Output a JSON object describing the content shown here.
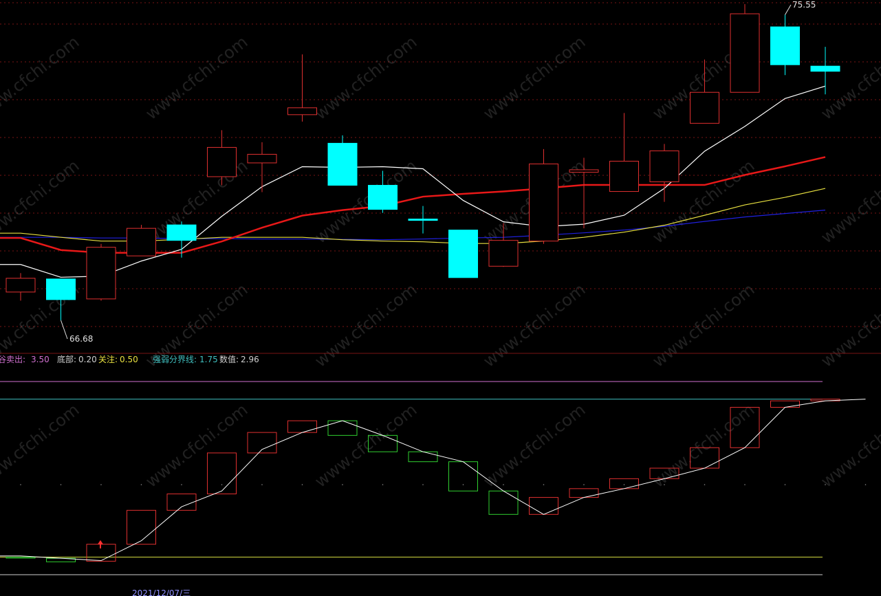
{
  "colors": {
    "background": "#000000",
    "up": "#e03030",
    "down": "#00ffff",
    "grid": "#7a1515",
    "ma5": "#ffffff",
    "ma10": "#e81818",
    "ma20": "#e8e040",
    "ma60": "#2020e0",
    "osc_up": "#e03030",
    "osc_down": "#30d030",
    "osc_line": "#ffffff",
    "line_sell": "#d070d0",
    "line_attention": "#40c0c0",
    "line_strong": "#d8e040",
    "line_bottom": "#d0d0d0"
  },
  "watermark": "www.cfchi.com",
  "price_panel": {
    "high_annotation": "75.55",
    "low_annotation": "66.68"
  },
  "indicator_panel": {
    "legend": [
      {
        "label": "谷卖出:",
        "value": "3.50",
        "color": "#d070d0"
      },
      {
        "label": "底部:",
        "value": "0.20",
        "color": "#d0d0d0"
      },
      {
        "label": "关注:",
        "value": "0.50",
        "color": "#e8e040"
      },
      {
        "label": "强弱分界线:",
        "value": "1.75",
        "color": "#40c0c0"
      },
      {
        "label": "数值:",
        "value": "2.96",
        "color": "#d0d0d0"
      }
    ],
    "bottom_date": "2021/12/07/三"
  },
  "chart_data": [
    {
      "type": "candlestick",
      "ylim": [
        65.9,
        75.9
      ],
      "candles": [
        {
          "o": 67.5,
          "c": 67.9,
          "h": 68.05,
          "l": 67.25,
          "dir": "up"
        },
        {
          "o": 67.88,
          "c": 67.28,
          "h": 67.88,
          "l": 66.68,
          "dir": "down"
        },
        {
          "o": 67.3,
          "c": 68.8,
          "h": 68.9,
          "l": 67.25,
          "dir": "up"
        },
        {
          "o": 68.55,
          "c": 69.35,
          "h": 69.45,
          "l": 68.55,
          "dir": "up"
        },
        {
          "o": 69.45,
          "c": 69.0,
          "h": 69.55,
          "l": 68.5,
          "dir": "down"
        },
        {
          "o": 70.85,
          "c": 71.7,
          "h": 72.2,
          "l": 70.6,
          "dir": "up"
        },
        {
          "o": 71.25,
          "c": 71.5,
          "h": 71.85,
          "l": 70.4,
          "dir": "up"
        },
        {
          "o": 72.65,
          "c": 72.85,
          "h": 74.4,
          "l": 72.45,
          "dir": "up"
        },
        {
          "o": 71.82,
          "c": 70.6,
          "h": 72.05,
          "l": 70.6,
          "dir": "down"
        },
        {
          "o": 70.6,
          "c": 69.9,
          "h": 71.02,
          "l": 69.8,
          "dir": "down"
        },
        {
          "o": 69.62,
          "c": 69.58,
          "h": 70.0,
          "l": 69.2,
          "dir": "down"
        },
        {
          "o": 69.3,
          "c": 67.92,
          "h": 69.3,
          "l": 67.92,
          "dir": "down"
        },
        {
          "o": 68.25,
          "c": 69.0,
          "h": 69.5,
          "l": 68.23,
          "dir": "up"
        },
        {
          "o": 68.98,
          "c": 71.22,
          "h": 71.65,
          "l": 68.9,
          "dir": "up"
        },
        {
          "o": 70.98,
          "c": 71.05,
          "h": 71.4,
          "l": 69.35,
          "dir": "up"
        },
        {
          "o": 70.42,
          "c": 71.3,
          "h": 72.7,
          "l": 70.42,
          "dir": "up"
        },
        {
          "o": 70.7,
          "c": 71.6,
          "h": 71.8,
          "l": 70.12,
          "dir": "up"
        },
        {
          "o": 72.4,
          "c": 73.3,
          "h": 74.25,
          "l": 72.4,
          "dir": "up"
        },
        {
          "o": 73.3,
          "c": 75.58,
          "h": 75.86,
          "l": 73.3,
          "dir": "up"
        },
        {
          "o": 75.2,
          "c": 74.1,
          "h": 75.55,
          "l": 73.8,
          "dir": "down"
        },
        {
          "o": 74.06,
          "c": 73.91,
          "h": 74.62,
          "l": 73.24,
          "dir": "down"
        }
      ],
      "ma_lines": [
        {
          "name": "MA5",
          "color": "#ffffff",
          "values": [
            68.3,
            67.93,
            67.96,
            68.4,
            68.74,
            69.7,
            70.56,
            71.14,
            71.12,
            71.14,
            71.08,
            70.16,
            69.54,
            69.4,
            69.47,
            69.73,
            70.51,
            71.59,
            72.31,
            73.12,
            73.48
          ]
        },
        {
          "name": "MA10",
          "color": "#e81818",
          "values": [
            69.07,
            68.72,
            68.64,
            68.64,
            68.64,
            68.97,
            69.37,
            69.72,
            69.88,
            70.0,
            70.27,
            70.35,
            70.42,
            70.51,
            70.61,
            70.61,
            70.61,
            70.61,
            70.9,
            71.15,
            71.42
          ]
        },
        {
          "name": "MA20",
          "color": "#e8e040",
          "values": [
            69.21,
            69.09,
            68.98,
            68.98,
            69.03,
            69.09,
            69.09,
            69.09,
            69.02,
            68.98,
            68.96,
            68.91,
            68.91,
            68.98,
            69.09,
            69.24,
            69.44,
            69.73,
            70.03,
            70.25,
            70.51
          ]
        },
        {
          "name": "MA60",
          "color": "#2020e0",
          "values": [
            69.09,
            69.09,
            69.07,
            69.07,
            69.05,
            69.05,
            69.04,
            69.04,
            69.03,
            69.02,
            69.04,
            69.07,
            69.09,
            69.15,
            69.22,
            69.3,
            69.41,
            69.55,
            69.68,
            69.78,
            69.88
          ]
        }
      ]
    },
    {
      "type": "indicator",
      "ylim": [
        0.0,
        3.7
      ],
      "reference_lines": [
        {
          "name": "谷卖出",
          "value": 3.5,
          "color": "#d070d0"
        },
        {
          "name": "强弱分界线",
          "value": 3.2,
          "color": "#40c0c0"
        },
        {
          "name": "关注",
          "value": 0.5,
          "color": "#d8e040"
        },
        {
          "name": "底部",
          "value": 0.2,
          "color": "#d0d0d0"
        }
      ],
      "boxes": [
        {
          "o": 0.5,
          "c": 0.5,
          "dir": "flat"
        },
        {
          "o": 0.48,
          "c": 0.42,
          "dir": "down"
        },
        {
          "o": 0.43,
          "c": 0.72,
          "dir": "up"
        },
        {
          "o": 0.72,
          "c": 1.3,
          "dir": "up"
        },
        {
          "o": 1.3,
          "c": 1.58,
          "dir": "up"
        },
        {
          "o": 1.58,
          "c": 2.28,
          "dir": "up"
        },
        {
          "o": 2.28,
          "c": 2.63,
          "dir": "up"
        },
        {
          "o": 2.63,
          "c": 2.83,
          "dir": "up"
        },
        {
          "o": 2.83,
          "c": 2.58,
          "dir": "down"
        },
        {
          "o": 2.58,
          "c": 2.3,
          "dir": "down"
        },
        {
          "o": 2.3,
          "c": 2.13,
          "dir": "down"
        },
        {
          "o": 2.13,
          "c": 1.63,
          "dir": "down"
        },
        {
          "o": 1.63,
          "c": 1.23,
          "dir": "down"
        },
        {
          "o": 1.23,
          "c": 1.52,
          "dir": "up"
        },
        {
          "o": 1.52,
          "c": 1.67,
          "dir": "up"
        },
        {
          "o": 1.67,
          "c": 1.84,
          "dir": "up"
        },
        {
          "o": 1.84,
          "c": 2.02,
          "dir": "up"
        },
        {
          "o": 2.02,
          "c": 2.37,
          "dir": "up"
        },
        {
          "o": 2.37,
          "c": 3.06,
          "dir": "up"
        },
        {
          "o": 3.06,
          "c": 3.17,
          "dir": "up"
        },
        {
          "o": 3.17,
          "c": 3.2,
          "dir": "up"
        }
      ],
      "line": [
        0.52,
        0.48,
        0.44,
        0.78,
        1.36,
        1.63,
        2.34,
        2.63,
        2.83,
        2.58,
        2.3,
        2.13,
        1.63,
        1.23,
        1.52,
        1.67,
        1.84,
        2.02,
        2.37,
        3.06,
        3.17,
        3.2
      ],
      "arrow_index": 2
    }
  ]
}
